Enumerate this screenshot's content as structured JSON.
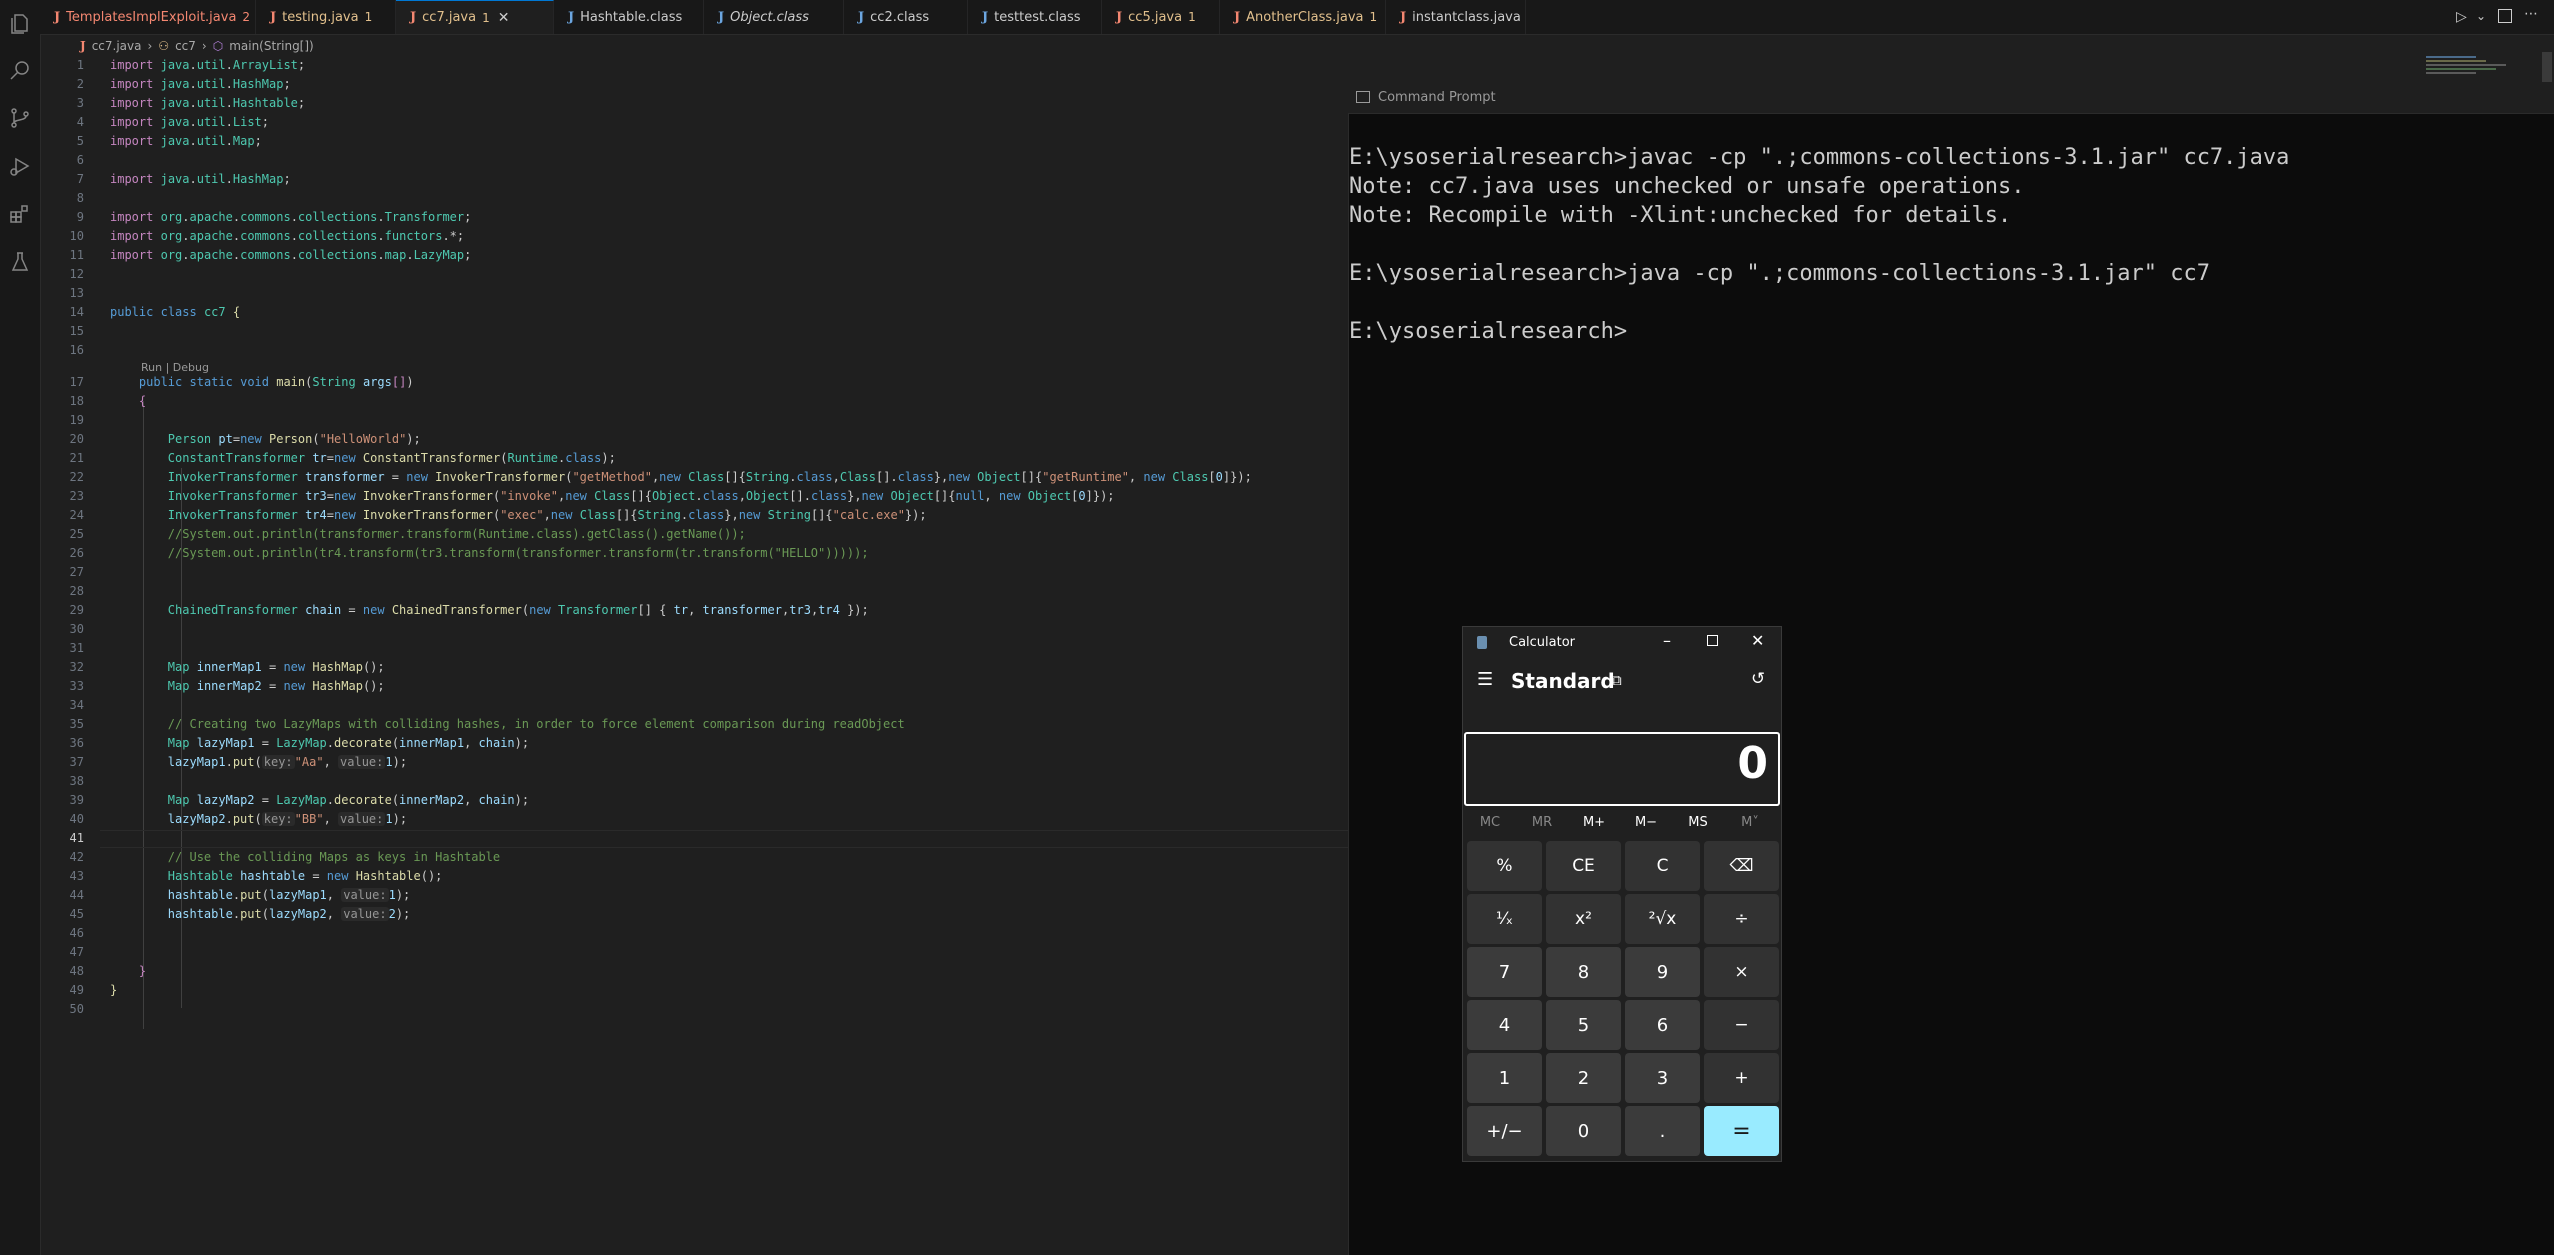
{
  "tabs": [
    {
      "label": "TemplatesImplExploit.java",
      "badge": "2",
      "style": "err2"
    },
    {
      "label": "testing.java",
      "badge": "1",
      "style": "warn"
    },
    {
      "label": "cc7.java",
      "badge": "1",
      "style": "warn",
      "active": true
    },
    {
      "label": "Hashtable.class",
      "badge": "",
      "style": ""
    },
    {
      "label": "Object.class",
      "badge": "",
      "style": ""
    },
    {
      "label": "cc2.class",
      "badge": "",
      "style": ""
    },
    {
      "label": "testtest.class",
      "badge": "",
      "style": ""
    },
    {
      "label": "cc5.java",
      "badge": "1",
      "style": "warn"
    },
    {
      "label": "AnotherClass.java",
      "badge": "1",
      "style": "warn"
    },
    {
      "label": "instantclass.java",
      "badge": "",
      "style": ""
    }
  ],
  "breadcrumb": {
    "file": "cc7.java",
    "cls": "cc7",
    "method": "main(String[])"
  },
  "codelens": "Run | Debug",
  "cmd": {
    "title": "Command Prompt",
    "lines": [
      "E:\\ysoserialresearch>javac -cp \".;commons-collections-3.1.jar\" cc7.java",
      "Note: cc7.java uses unchecked or unsafe operations.",
      "Note: Recompile with -Xlint:unchecked for details.",
      "",
      "E:\\ysoserialresearch>java -cp \".;commons-collections-3.1.jar\" cc7",
      "",
      "E:\\ysoserialresearch>"
    ]
  },
  "calculator": {
    "title": "Calculator",
    "mode": "Standard",
    "display": "0",
    "memory": [
      "MC",
      "MR",
      "M+",
      "M−",
      "MS",
      "M˅"
    ],
    "buttons": [
      [
        "%",
        "CE",
        "C",
        "⌫"
      ],
      [
        "¹⁄ₓ",
        "x²",
        "²√x",
        "÷"
      ],
      [
        "7",
        "8",
        "9",
        "×"
      ],
      [
        "4",
        "5",
        "6",
        "−"
      ],
      [
        "1",
        "2",
        "3",
        "+"
      ],
      [
        "+/−",
        "0",
        ".",
        "="
      ]
    ]
  }
}
